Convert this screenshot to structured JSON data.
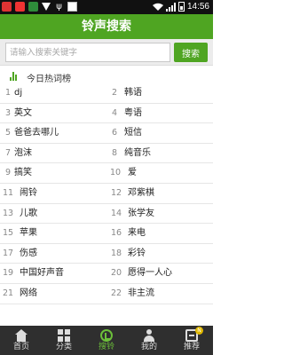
{
  "status_bar": {
    "time": "14:56"
  },
  "header": {
    "title": "铃声搜索"
  },
  "search": {
    "placeholder": "请输入搜索关键字",
    "button_label": "搜索"
  },
  "hot": {
    "title": "今日热词榜",
    "items": [
      {
        "rank": "1",
        "keyword": "dj"
      },
      {
        "rank": "2",
        "keyword": "韩语"
      },
      {
        "rank": "3",
        "keyword": "英文"
      },
      {
        "rank": "4",
        "keyword": "粤语"
      },
      {
        "rank": "5",
        "keyword": "爸爸去哪儿"
      },
      {
        "rank": "6",
        "keyword": "短信"
      },
      {
        "rank": "7",
        "keyword": "泡沫"
      },
      {
        "rank": "8",
        "keyword": "纯音乐"
      },
      {
        "rank": "9",
        "keyword": "搞笑"
      },
      {
        "rank": "10",
        "keyword": "爱"
      },
      {
        "rank": "11",
        "keyword": "闹铃"
      },
      {
        "rank": "12",
        "keyword": "邓紫棋"
      },
      {
        "rank": "13",
        "keyword": "儿歌"
      },
      {
        "rank": "14",
        "keyword": "张学友"
      },
      {
        "rank": "15",
        "keyword": "苹果"
      },
      {
        "rank": "16",
        "keyword": "来电"
      },
      {
        "rank": "17",
        "keyword": "伤感"
      },
      {
        "rank": "18",
        "keyword": "彩铃"
      },
      {
        "rank": "19",
        "keyword": "中国好声音"
      },
      {
        "rank": "20",
        "keyword": "愿得一人心"
      },
      {
        "rank": "21",
        "keyword": "网络"
      },
      {
        "rank": "22",
        "keyword": "非主流"
      }
    ]
  },
  "bottom_nav": {
    "items": [
      {
        "label": "首页",
        "icon": "home-icon"
      },
      {
        "label": "分类",
        "icon": "grid-icon"
      },
      {
        "label": "搜铃",
        "icon": "ringtone-search-icon",
        "active": true
      },
      {
        "label": "我的",
        "icon": "user-icon"
      },
      {
        "label": "推荐",
        "icon": "recommend-icon",
        "badge": "N"
      }
    ]
  },
  "colors": {
    "accent": "#4fa522",
    "nav_background": "#2f2f2f",
    "active_nav": "#6cbf3a"
  }
}
